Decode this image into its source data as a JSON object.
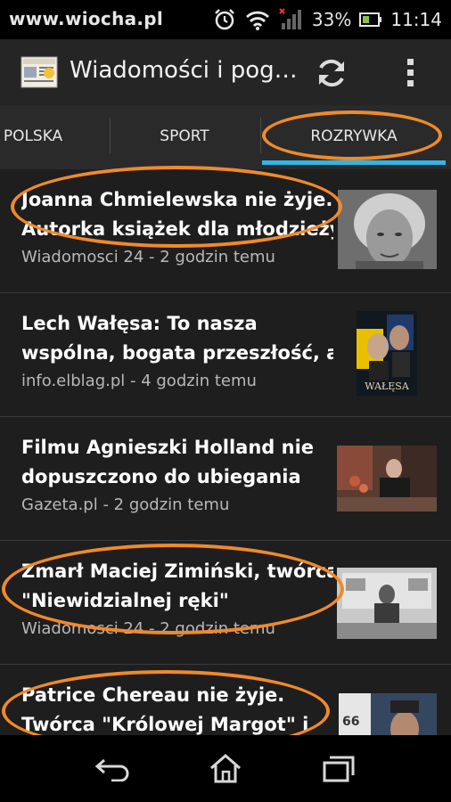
{
  "watermark": "www.wiocha.pl",
  "status": {
    "battery": "33%",
    "time": "11:14"
  },
  "app": {
    "title": "Wiadomości i pog…"
  },
  "tabs": [
    {
      "label": "POLSKA"
    },
    {
      "label": "SPORT"
    },
    {
      "label": "ROZRYWKA",
      "selected": true
    }
  ],
  "news": [
    {
      "title_line1": "Joanna Chmielewska nie żyje.",
      "title_line2": "Autorka książek dla młodzieży",
      "source": "Wiadomosci 24 - 2 godzin temu"
    },
    {
      "title_line1": "Lech Wałęsa: To nasza",
      "title_line2": "wspólna, bogata przeszłość, a",
      "source": "info.elblag.pl - 4 godzin temu",
      "thumb_caption": "WAŁĘSA"
    },
    {
      "title_line1": "Filmu Agnieszki Holland nie",
      "title_line2": "dopuszczono do ubiegania",
      "source": "Gazeta.pl - 2 godzin temu"
    },
    {
      "title_line1": "Zmarł Maciej Zimiński, twórca",
      "title_line2": "\"Niewidzialnej ręki\"",
      "source": "Wiadomosci 24 - 2 godzin temu"
    },
    {
      "title_line1": "Patrice Chereau nie żyje.",
      "title_line2": "Twórca \"Królowej Margot\" i",
      "thumb_caption": "66"
    }
  ],
  "colors": {
    "accent": "#33b5e5",
    "annotation": "#f08a2a",
    "background": "#1e1e1e"
  }
}
